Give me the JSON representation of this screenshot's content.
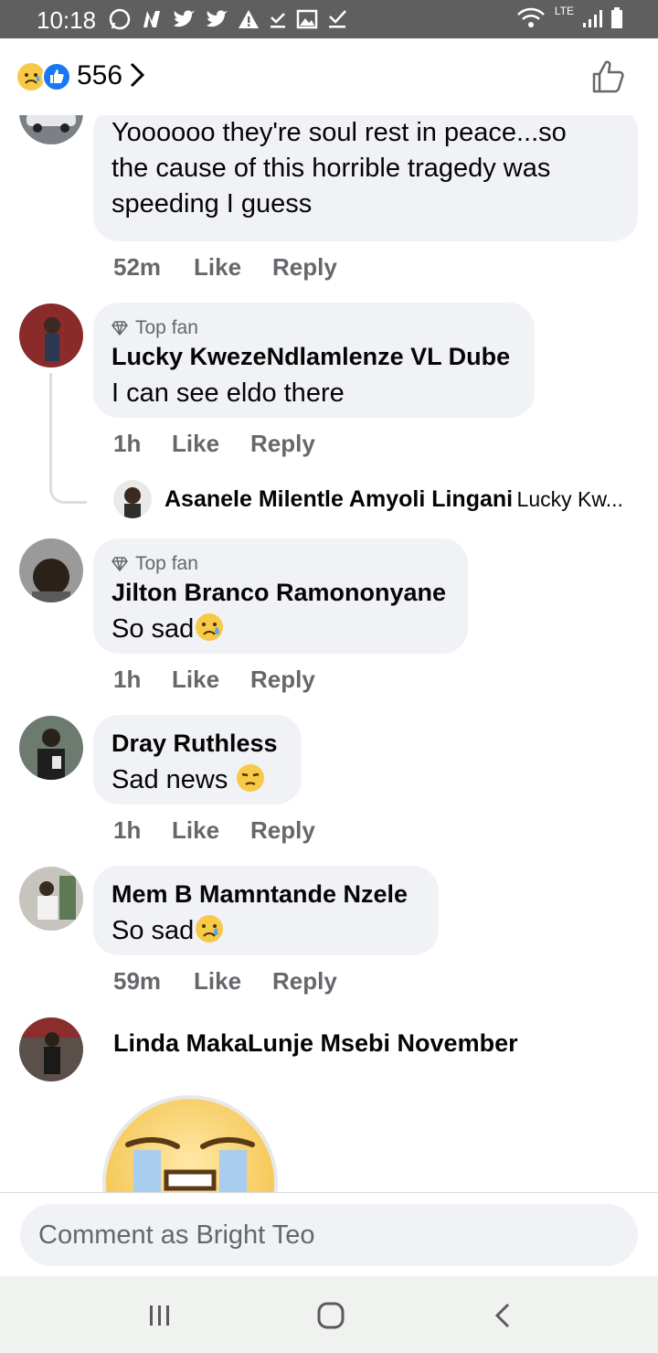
{
  "status": {
    "time": "10:18",
    "network": "LTE"
  },
  "header": {
    "reaction_count": "556"
  },
  "comments": [
    {
      "text_lines": [
        "Yoooooo they're soul rest in peace...so",
        "the cause of this horrible tragedy was",
        "speeding I guess"
      ],
      "time": "52m",
      "like": "Like",
      "reply": "Reply"
    },
    {
      "badge": "Top fan",
      "author": "Lucky KwezeNdlamlenze VL Dube",
      "text": "I can see eldo there",
      "time": "1h",
      "like": "Like",
      "reply": "Reply",
      "reply_preview": {
        "author": "Asanele Milentle Amyoli Lingani",
        "snippet": "Lucky Kw..."
      }
    },
    {
      "badge": "Top fan",
      "author": "Jilton Branco Ramononyane",
      "text": "So sad",
      "time": "1h",
      "like": "Like",
      "reply": "Reply"
    },
    {
      "author": "Dray Ruthless",
      "text": "Sad news ",
      "time": "1h",
      "like": "Like",
      "reply": "Reply"
    },
    {
      "author": "Mem B Mamntande Nzele",
      "text": "So sad",
      "time": "59m",
      "like": "Like",
      "reply": "Reply"
    },
    {
      "author": "Linda MakaLunje Msebi November"
    }
  ],
  "composer": {
    "placeholder": "Comment as Bright Teo"
  },
  "icons": {
    "sad_reaction": "sad-face-icon",
    "like_reaction": "like-icon",
    "top_fan": "diamond-icon",
    "crying": "crying-face-icon",
    "unamused": "unamused-face-icon"
  },
  "colors": {
    "bubble": "#f0f2f5",
    "accent": "#1877f2",
    "secondary_text": "#65676b"
  }
}
